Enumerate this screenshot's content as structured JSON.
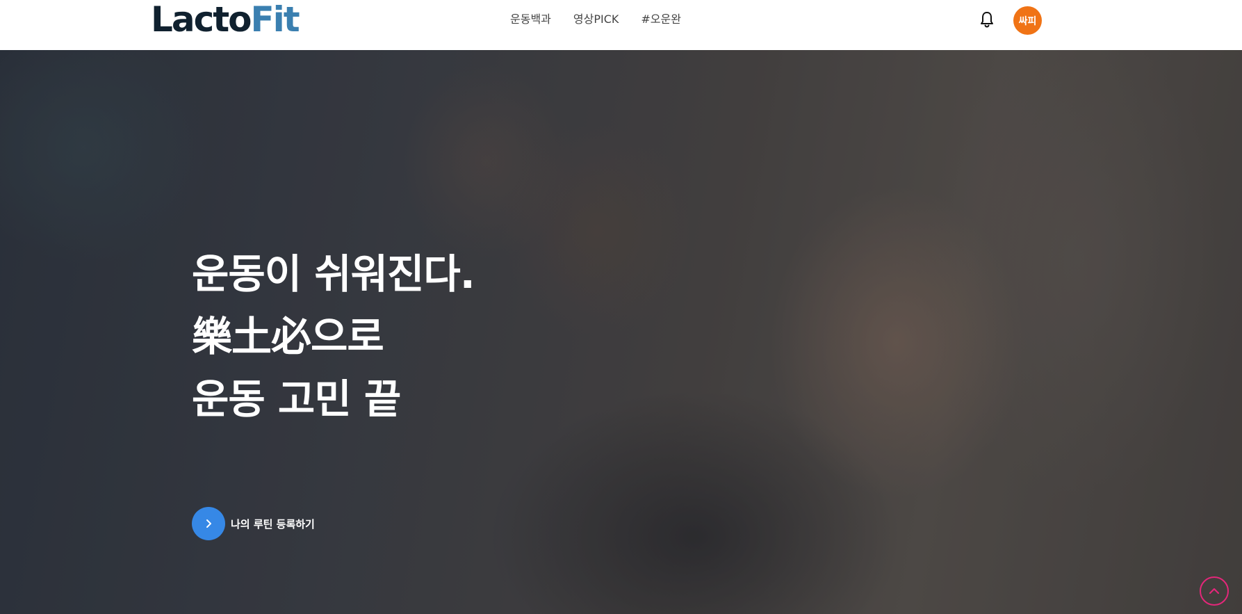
{
  "header": {
    "logo_part1": "Lacto",
    "logo_part2": "Fit",
    "nav": [
      "운동백과",
      "영상PICK",
      "#오운완"
    ],
    "notification_icon": "bell-icon",
    "avatar_label": "싸피"
  },
  "hero": {
    "headline_line1": "운동이 쉬워진다.",
    "headline_line2": "樂土必으로",
    "headline_line3": "운동 고민 끝",
    "cta_icon": "chevron-right-icon",
    "cta_label": "나의 루틴 등록하기"
  },
  "scroll_top_icon": "chevron-up-icon",
  "colors": {
    "logo_dark": "#10212f",
    "logo_accent": "#3a7fb0",
    "avatar_bg": "#f07315",
    "cta_bg": "#3688e6",
    "scroll_top_border": "#e4277a"
  }
}
